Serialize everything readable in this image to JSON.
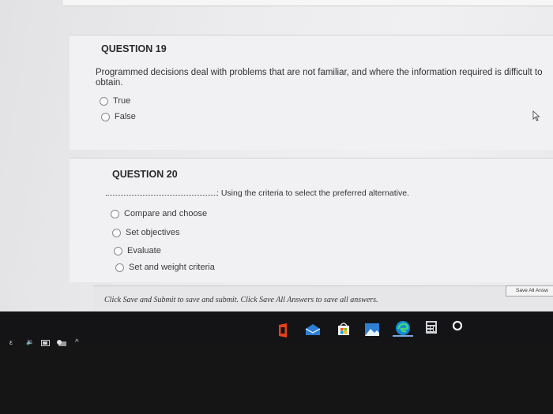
{
  "q19": {
    "title": "QUESTION 19",
    "text": "Programmed decisions deal with problems that are not familiar, and where the information required is difficult to obtain.",
    "options": [
      "True",
      "False"
    ]
  },
  "q20": {
    "title": "QUESTION 20",
    "prompt_suffix": ": Using the criteria to select the preferred alternative.",
    "options": [
      "Compare and choose",
      "Set objectives",
      "Evaluate",
      "Set and weight criteria"
    ]
  },
  "footer": {
    "instructions": "Click Save and Submit to save and submit. Click Save All Answers to save all answers.",
    "save_all_label": "Save All Answ"
  },
  "taskbar": {
    "icons": [
      "office-icon",
      "mail-icon",
      "store-icon",
      "photos-icon",
      "edge-icon",
      "calculator-icon",
      "cortana-icon"
    ],
    "tray": {
      "left_glyph": "ε",
      "volume": "🔉",
      "chevron": "^"
    }
  }
}
